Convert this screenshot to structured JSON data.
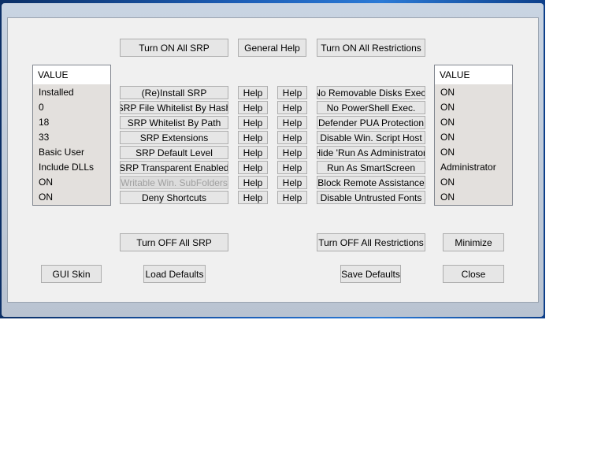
{
  "top_buttons": {
    "turn_on_all_srp": "Turn ON All SRP",
    "general_help": "General Help",
    "turn_on_all_restrictions": "Turn ON All Restrictions"
  },
  "left_list": {
    "header": "VALUE",
    "values": [
      "Installed",
      "0",
      "18",
      "33",
      "Basic User",
      "Include DLLs",
      "ON",
      "ON"
    ]
  },
  "srp_options": [
    {
      "label": "(Re)Install SRP",
      "disabled": false
    },
    {
      "label": "SRP File Whitelist By Hash",
      "disabled": false
    },
    {
      "label": "SRP Whitelist By Path",
      "disabled": false
    },
    {
      "label": "SRP Extensions",
      "disabled": false
    },
    {
      "label": "SRP Default Level",
      "disabled": false
    },
    {
      "label": "SRP Transparent Enabled",
      "disabled": false
    },
    {
      "label": "Writable Win. SubFolders",
      "disabled": true
    },
    {
      "label": "Deny Shortcuts",
      "disabled": false
    }
  ],
  "help_label": "Help",
  "restriction_options": [
    "No Removable Disks Exec.",
    "No PowerShell Exec.",
    "Defender PUA Protection",
    "Disable Win. Script Host",
    "Hide  'Run As Administrator'",
    "Run As SmartScreen",
    "Block Remote Assistance",
    "Disable Untrusted Fonts"
  ],
  "right_list": {
    "header": "VALUE",
    "values": [
      "ON",
      "ON",
      "ON",
      "ON",
      "ON",
      "Administrator",
      "ON",
      "ON"
    ]
  },
  "bottom_buttons": {
    "turn_off_all_srp": "Turn OFF All SRP",
    "turn_off_all_restrictions": "Turn OFF All Restrictions",
    "minimize": "Minimize",
    "gui_skin": "GUI Skin",
    "load_defaults": "Load Defaults",
    "save_defaults": "Save Defaults",
    "close": "Close"
  }
}
